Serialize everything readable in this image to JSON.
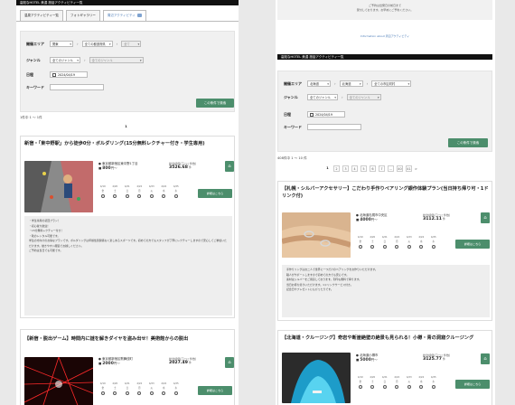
{
  "left": {
    "topbar": "高知なHOTEL 美濃 旅話アクティビティ一覧",
    "tabs": [
      "温泉アクティビティ一覧",
      "フォトギャラリー",
      "周辺アクティビティ"
    ],
    "search": {
      "area_label": "開催エリア",
      "area_values": [
        "関東",
        "全ての都道府県",
        "全て"
      ],
      "genre_label": "ジャンル",
      "genre_values": [
        "全てのジャンル",
        "全てのジャンル"
      ],
      "date_label": "日程",
      "date_value": "2024/04/19",
      "keyword_label": "キーワード",
      "keyword_value": "",
      "submit": "この条件で検索"
    },
    "count": "1件中 1 ～ 1件",
    "page": "1",
    "cards": [
      {
        "title": "新宿・「東中野駅」から徒歩0分・ボルダリング(15分無料レクチャー付き・学生専用)",
        "location": "東京都新宿区東中野1丁目",
        "price": "800",
        "price_unit": "円〜",
        "rating_label": "総合評価(口コミ件数)",
        "rating": "3526.68",
        "rating_unit": "件",
        "dates": [
          "4/19",
          "4/20",
          "4/21",
          "4/22",
          "4/23",
          "4/24",
          "4/25"
        ],
        "days": [
          "金",
          "土",
          "日",
          "月",
          "火",
          "水",
          "木"
        ],
        "detail_button": "詳細はこちら",
        "description": [
          "・学生専用の初回プラン！",
          "・初心者大歓迎！",
          "・15分無料レクチャー付き！",
          "・靴のレンタル可能です。",
          "学生の方向けのお得なプランです。ボルダリングは年齢性別関係なく楽しめるスポーツです。初めての方でもスタッフが丁寧にレクチャーしますので安心してご参加いただけます。動きやすい服装でお越しください。",
          "ご予約は当日でも可能です。"
        ]
      },
      {
        "title": "【新宿・脱出ゲーム】時間内に謎を解きダイヤを盗み出せ！美術館からの脱出",
        "location": "東京都新宿区歌舞伎町",
        "price": "2000",
        "price_unit": "円〜",
        "rating_label": "総合評価(口コミ件数)",
        "rating": "2027.49",
        "rating_unit": "件",
        "dates": [
          "4/19",
          "4/20",
          "4/21",
          "4/22",
          "4/23",
          "4/24",
          "4/25"
        ],
        "days": [
          "金",
          "土",
          "日",
          "月",
          "火",
          "水",
          "木"
        ],
        "detail_button": "詳細はこちら"
      }
    ]
  },
  "right": {
    "gray_lines": [
      "ご予約は出発日の前日まで",
      "受付しております。お早めにご予約ください。"
    ],
    "infolink": "Information about 周辺アクティビティ",
    "topbar": "高知なHOTEL 美濃 旅話アクティビティ一覧",
    "search": {
      "area_label": "開催エリア",
      "area_values": [
        "北海道",
        "北海道",
        "全ての市区町村"
      ],
      "genre_label": "ジャンル",
      "genre_values": [
        "全てのジャンル",
        "全てのジャンル"
      ],
      "date_label": "日程",
      "date_value": "2024/04/19",
      "keyword_label": "キーワード",
      "keyword_value": "",
      "submit": "この条件で検索"
    },
    "count": "408件中 1 ～ 10 件",
    "pages": [
      "1",
      "2",
      "3",
      "4",
      "5",
      "6",
      "7",
      "…",
      "40",
      "41"
    ],
    "next": ">",
    "cards": [
      {
        "title": "【札幌・シルバーアクセサリー】こだわり手作りペアリング銀作体験プラン(当日持ち帰り可・1ドリンク付)",
        "location": "北海道札幌市中央区",
        "price": "4000",
        "price_unit": "円〜",
        "rating_label": "総合評価(口コミ件数)",
        "rating": "3112.11",
        "rating_unit": "件",
        "dates": [
          "4/19",
          "4/20",
          "4/21",
          "4/22",
          "4/23",
          "4/24",
          "4/25"
        ],
        "days": [
          "金",
          "土",
          "日",
          "月",
          "火",
          "水",
          "木"
        ],
        "detail_button": "詳細はこちら",
        "description": [
          "手作りリングはお二人で世界に一つだけのペアリングをお作りいただけます。",
          "職人がサポートしますので初めての方でも安心です。",
          "素材はシルバーをご用意しております。刻印も無料で承ります。",
          "当日お持ち帰りいただけます。1ドリンクサービス付き。",
          "記念日やプレゼントにもぴったりです。"
        ]
      },
      {
        "title": "【北海道・クルージング】奇岩や断崖絶壁の絶景も見られる！小樽・青の洞窟クルージング",
        "location": "北海道小樽市",
        "price": "5000",
        "price_unit": "円〜",
        "rating_label": "総合評価(口コミ件数)",
        "rating": "3125.77",
        "rating_unit": "件",
        "dates": [
          "4/19",
          "4/20",
          "4/21",
          "4/22",
          "4/23",
          "4/24",
          "4/25"
        ],
        "days": [
          "金",
          "土",
          "日",
          "月",
          "火",
          "水",
          "木"
        ],
        "detail_button": "詳細はこちら"
      }
    ]
  },
  "colors": {
    "accent": "#4c8e6c",
    "link": "#4a7bb7",
    "topbar": "#111111",
    "panel": "#f0f0f0"
  }
}
